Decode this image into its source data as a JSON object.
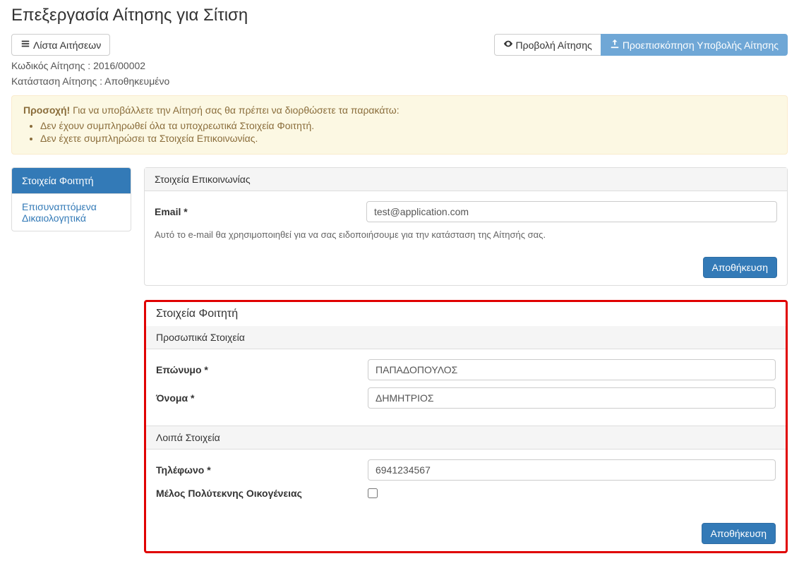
{
  "page": {
    "title": "Επεξεργασία Αίτησης για Σίτιση"
  },
  "buttons": {
    "list_applications": "Λίστα Αιτήσεων",
    "view_application": "Προβολή Αίτησης",
    "preview_submit": "Προεπισκόπηση Υποβολής Αίτησης",
    "save": "Αποθήκευση"
  },
  "meta": {
    "code_label": "Κωδικός Αίτησης : ",
    "code_value": "2016/00002",
    "status_label": "Κατάσταση Αίτησης : ",
    "status_value": "Αποθηκευμένο"
  },
  "alert": {
    "strong": "Προσοχή!",
    "text": " Για να υποβάλλετε την Αίτησή σας θα πρέπει να διορθώσετε τα παρακάτω:",
    "items": [
      "Δεν έχουν συμπληρωθεί όλα τα υποχρεωτικά Στοιχεία Φοιτητή.",
      "Δεν έχετε συμπληρώσει τα Στοιχεία Επικοινωνίας."
    ]
  },
  "sidebar": {
    "items": [
      {
        "label": "Στοιχεία Φοιτητή",
        "active": true
      },
      {
        "label": "Επισυναπτόμενα Δικαιολογητικά",
        "active": false
      }
    ]
  },
  "contact_panel": {
    "heading": "Στοιχεία Επικοινωνίας",
    "email_label": "Email *",
    "email_value": "test@application.com",
    "email_help": "Αυτό το e-mail θα χρησιμοποιηθεί για να σας ειδοποιήσουμε για την κατάσταση της Αίτησής σας."
  },
  "student_panel": {
    "title": "Στοιχεία Φοιτητή",
    "personal_heading": "Προσωπικά Στοιχεία",
    "surname_label": "Επώνυμο *",
    "surname_value": "ΠΑΠΑΔΟΠΟΥΛΟΣ",
    "name_label": "Όνομα *",
    "name_value": "ΔΗΜΗΤΡΙΟΣ",
    "other_heading": "Λοιπά Στοιχεία",
    "phone_label": "Τηλέφωνο *",
    "phone_value": "6941234567",
    "family_label": "Μέλος Πολύτεκνης Οικογένειας",
    "family_checked": false
  }
}
